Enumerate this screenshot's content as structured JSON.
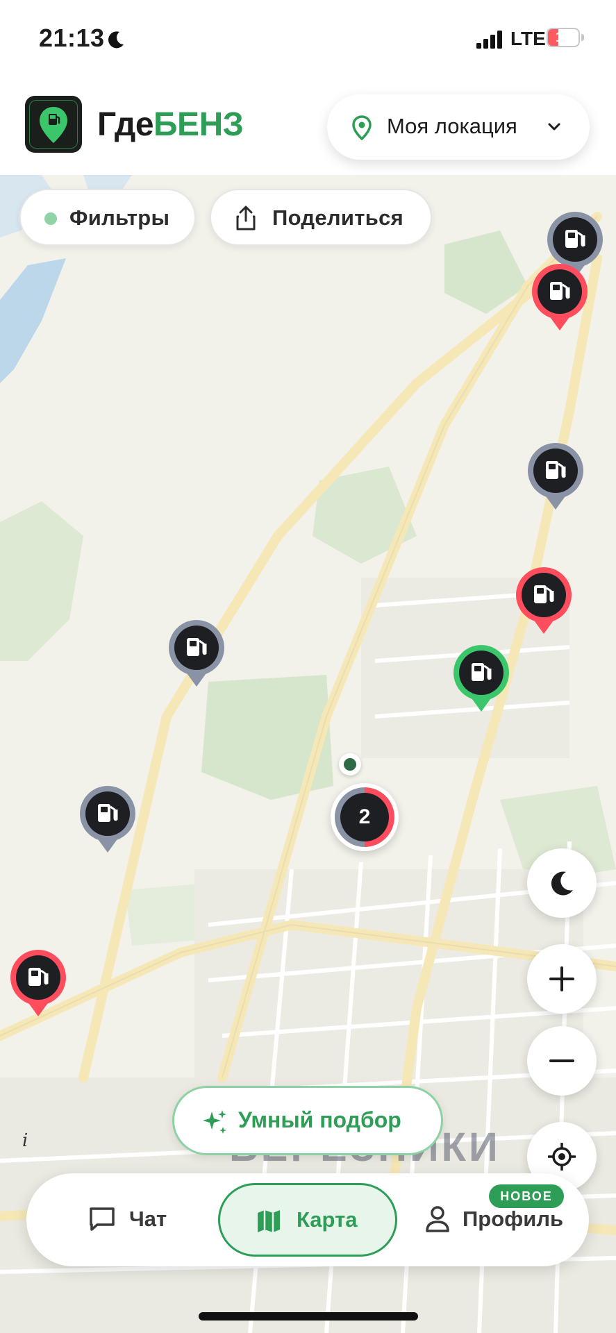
{
  "status_bar": {
    "time": "21:13",
    "network": "LTE",
    "battery": "14",
    "battery_level": 0.14
  },
  "header": {
    "app_name_part1": "Где",
    "app_name_part2": "БЕНЗ",
    "location_label": "Моя локация"
  },
  "map": {
    "chips": {
      "filters": "Фильтры",
      "share": "Поделиться"
    },
    "cluster_count": "2",
    "station_pins": [
      {
        "status": "gray"
      },
      {
        "status": "red"
      },
      {
        "status": "gray"
      },
      {
        "status": "red"
      },
      {
        "status": "gray"
      },
      {
        "status": "green"
      },
      {
        "status": "gray"
      },
      {
        "status": "red"
      }
    ],
    "district_label": "БЕРЕЗНИКИ",
    "info_glyph": "i",
    "smart_pick": "Умный подбор"
  },
  "colors": {
    "accent": "#2e9e57",
    "red": "#ff4d5e",
    "gray": "#8a92a6",
    "green": "#3cc66b",
    "dark": "#1d1f23"
  },
  "bottom_nav": {
    "chat": "Чат",
    "map": "Карта",
    "profile": "Профиль",
    "new_badge": "НОВОЕ"
  },
  "icons": [
    "moon-icon",
    "location-pin-icon",
    "chevron-down-icon",
    "share-icon",
    "fuel-pump-icon",
    "zoom-in-icon",
    "zoom-out-icon",
    "locate-icon",
    "sparkle-icon",
    "chat-icon",
    "map-icon",
    "profile-icon"
  ]
}
